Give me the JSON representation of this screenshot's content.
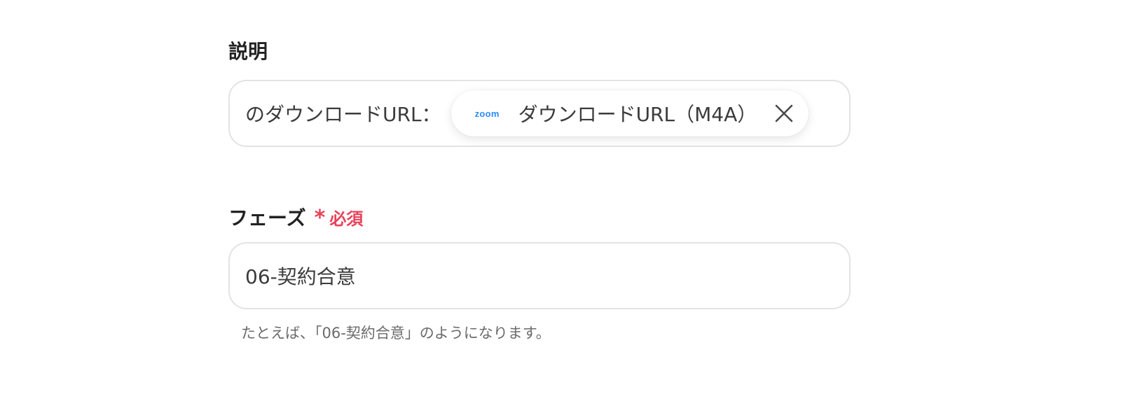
{
  "description_field": {
    "label": "説明",
    "prefix_text": "のダウンロードURL：",
    "chip": {
      "source_logo": "zoom",
      "label": "ダウンロードURL（M4A）",
      "close_icon": "close-icon"
    }
  },
  "phase_field": {
    "label": "フェーズ",
    "required_mark": "*",
    "required_text": "必須",
    "value": "06-契約合意",
    "hint": "たとえば、「06-契約合意」のようになります。"
  },
  "colors": {
    "required": "#e8425a",
    "zoom_brand": "#2d8cff",
    "border": "#e3e3e6"
  }
}
